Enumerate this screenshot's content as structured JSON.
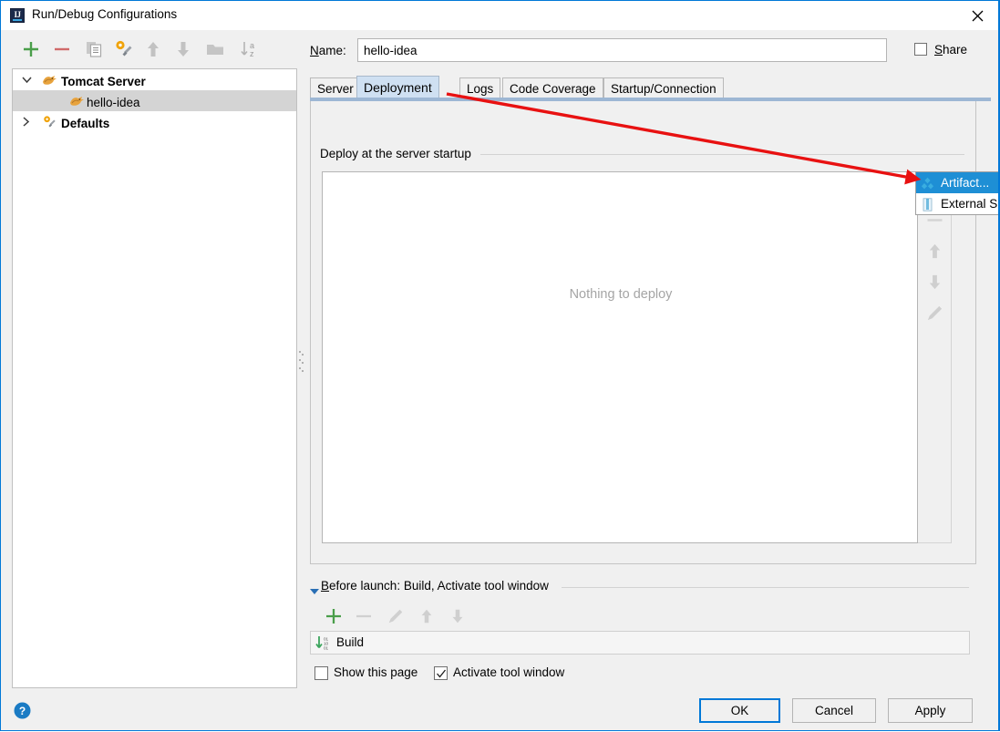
{
  "window": {
    "title": "Run/Debug Configurations",
    "app_icon": "intellij-idea-icon",
    "close_icon": "close-icon",
    "accent_color": "#0078d7"
  },
  "left_toolbar": {
    "buttons": [
      {
        "name": "add-configuration-button",
        "icon": "plus-icon"
      },
      {
        "name": "remove-configuration-button",
        "icon": "minus-icon"
      },
      {
        "name": "copy-configuration-button",
        "icon": "copy-icon"
      },
      {
        "name": "edit-defaults-button",
        "icon": "wrench-gear-icon"
      },
      {
        "name": "move-up-button",
        "icon": "arrow-up-icon"
      },
      {
        "name": "move-down-button",
        "icon": "arrow-down-icon"
      },
      {
        "name": "create-folder-button",
        "icon": "folder-icon"
      },
      {
        "name": "sort-alphabetically-button",
        "icon": "sort-az-icon"
      }
    ]
  },
  "tree": {
    "items": [
      {
        "label": "Tomcat Server",
        "icon": "tomcat-icon",
        "twisty": "chevron-down-icon",
        "bold": true,
        "selected": false
      },
      {
        "label": "hello-idea",
        "icon": "tomcat-icon",
        "twisty": "",
        "bold": false,
        "selected": true
      },
      {
        "label": "Defaults",
        "icon": "wrench-gear-icon",
        "twisty": "chevron-right-icon",
        "bold": true,
        "selected": false
      }
    ]
  },
  "name_field": {
    "label": "Name:",
    "label_mnemonic": "N",
    "value": "hello-idea",
    "placeholder": "Name"
  },
  "share": {
    "label": "Share",
    "label_mnemonic": "S",
    "checked": false
  },
  "tabs": [
    {
      "label": "Server",
      "active": false
    },
    {
      "label": "Deployment",
      "active": true
    },
    {
      "label": "Logs",
      "active": false
    },
    {
      "label": "Code Coverage",
      "active": false
    },
    {
      "label": "Startup/Connection",
      "active": false
    }
  ],
  "deploy_section": {
    "legend": "Deploy at the server startup",
    "empty_text": "Nothing to deploy",
    "toolbar": [
      {
        "name": "add-deployment-button",
        "icon": "plus-icon",
        "enabled": true
      },
      {
        "name": "remove-deployment-button",
        "icon": "minus-icon",
        "enabled": false
      },
      {
        "name": "move-deployment-up-button",
        "icon": "arrow-up-icon",
        "enabled": false
      },
      {
        "name": "move-deployment-down-button",
        "icon": "arrow-down-icon",
        "enabled": false
      },
      {
        "name": "edit-deployment-button",
        "icon": "pencil-icon",
        "enabled": false
      }
    ]
  },
  "popup_menu": {
    "items": [
      {
        "label": "Artifact...",
        "icon": "artifact-icon",
        "highlighted": true
      },
      {
        "label": "External S…",
        "icon": "archive-icon",
        "highlighted": false
      }
    ]
  },
  "before_launch": {
    "title": "Before launch: Build, Activate tool window",
    "title_mnemonic": "B",
    "collapse_icon": "triangle-down-icon",
    "toolbar": [
      {
        "name": "add-task-button",
        "icon": "plus-icon",
        "enabled": true
      },
      {
        "name": "remove-task-button",
        "icon": "minus-icon",
        "enabled": false
      },
      {
        "name": "edit-task-button",
        "icon": "pencil-icon",
        "enabled": false
      },
      {
        "name": "move-task-up-button",
        "icon": "arrow-up-icon",
        "enabled": false
      },
      {
        "name": "move-task-down-button",
        "icon": "arrow-down-icon",
        "enabled": false
      }
    ],
    "tasks": [
      {
        "label": "Build",
        "icon": "build-icon"
      }
    ],
    "show_this_page": {
      "label": "Show this page",
      "checked": false
    },
    "activate_tool_window": {
      "label": "Activate tool window",
      "checked": true
    }
  },
  "footer": {
    "help_icon": "help-icon",
    "ok_label": "OK",
    "cancel_label": "Cancel",
    "apply_label": "Apply"
  },
  "annotation": {
    "type": "red-arrow",
    "color": "#e81111",
    "from_label": "Deployment tab",
    "to_label": "Artifact... menu item"
  }
}
